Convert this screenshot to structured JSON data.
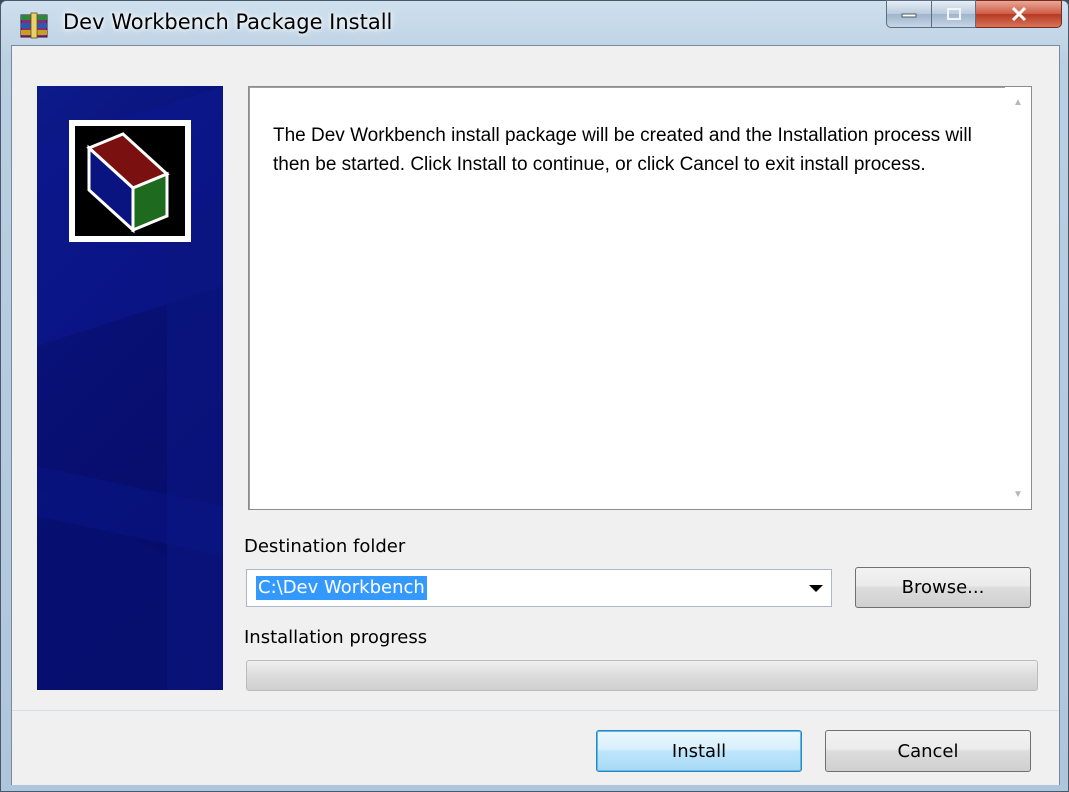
{
  "window": {
    "title": "Dev Workbench Package Install",
    "icon": "winrar-archive-icon",
    "controls": {
      "minimize": "minimize-icon",
      "maximize": "maximize-icon",
      "close": "close-icon"
    }
  },
  "banner": {
    "logo": "package-box-icon",
    "colors": {
      "background": "#081075",
      "box_top": "#7a1010",
      "box_side": "#1e6a1e",
      "box_front": "#0a1480"
    }
  },
  "info": {
    "text": "The Dev Workbench install package will be created and the Installation process will then be started.  Click Install to continue, or click Cancel to exit install process."
  },
  "destination": {
    "label": "Destination folder",
    "value": "C:\\Dev Workbench",
    "browse_label": "Browse..."
  },
  "progress": {
    "label": "Installation progress",
    "value": 0
  },
  "footer": {
    "install_label": "Install",
    "cancel_label": "Cancel"
  }
}
